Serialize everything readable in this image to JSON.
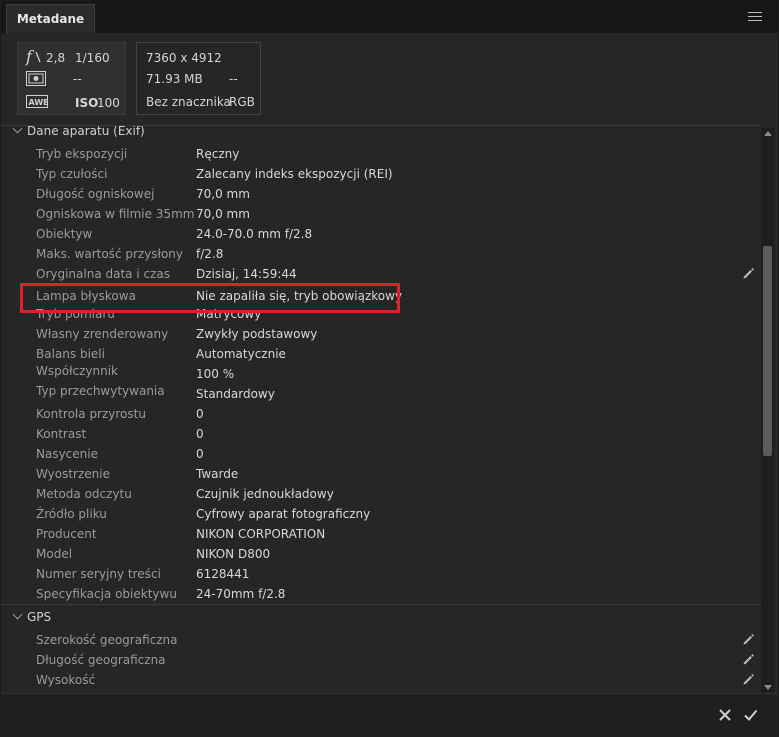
{
  "panel": {
    "tab_label": "Metadane"
  },
  "summary": {
    "aperture": "2,8",
    "shutter": "1/160",
    "metering_value": "--",
    "wb_value": "",
    "iso_label": "ISO",
    "iso_value": "100",
    "dimensions": "7360 x 4912",
    "file_size": "71.93 MB",
    "resolution": "--",
    "label": "Bez znacznika",
    "color_mode": "RGB"
  },
  "sections": {
    "exif_title": "Dane aparatu (Exif)",
    "gps_title": "GPS"
  },
  "exif_rows": [
    {
      "label": "Tryb ekspozycji",
      "value": "Ręczny"
    },
    {
      "label": "Typ czułości",
      "value": "Zalecany indeks ekspozycji (REI)"
    },
    {
      "label": "Długość ogniskowej",
      "value": "70,0 mm"
    },
    {
      "label": "Ogniskowa w filmie 35mm",
      "value": "70,0 mm"
    },
    {
      "label": "Obiektyw",
      "value": "24.0-70.0 mm f/2.8"
    },
    {
      "label": "Maks. wartość przysłony",
      "value": "f/2.8"
    },
    {
      "label": "Oryginalna data i czas",
      "value": "Dzisiaj, 14:59:44"
    },
    {
      "label": "Lampa błyskowa",
      "value": "Nie zapaliła się, tryb obowiązkowy"
    },
    {
      "label": "Tryb pomiaru",
      "value": "Matrycowy"
    },
    {
      "label": "Własny zrenderowany",
      "value": "Zwykły podstawowy"
    },
    {
      "label": "Balans bieli",
      "value": "Automatycznie"
    },
    {
      "label": "Współczynnik",
      "value": "100 %"
    },
    {
      "label": "Typ przechwytywania",
      "value": "Standardowy"
    },
    {
      "label": "Kontrola przyrostu",
      "value": "0"
    },
    {
      "label": "Kontrast",
      "value": "0"
    },
    {
      "label": "Nasycenie",
      "value": "0"
    },
    {
      "label": "Wyostrzenie",
      "value": "Twarde"
    },
    {
      "label": "Metoda odczytu",
      "value": "Czujnik jednoukładowy"
    },
    {
      "label": "Źródło pliku",
      "value": "Cyfrowy aparat fotograficzny"
    },
    {
      "label": "Producent",
      "value": "NIKON CORPORATION"
    },
    {
      "label": "Model",
      "value": "NIKON D800"
    },
    {
      "label": "Numer seryjny treści",
      "value": "6128441"
    },
    {
      "label": "Specyfikacja obiektywu",
      "value": "24-70mm f/2.8"
    }
  ],
  "gps_rows": [
    {
      "label": "Szerokość geograficzna",
      "value": ""
    },
    {
      "label": "Długość geograficzna",
      "value": ""
    },
    {
      "label": "Wysokość",
      "value": ""
    }
  ],
  "icons": {
    "aperture": "aperture-f-icon",
    "metering": "metering-mode-icon",
    "white_balance": "awb-icon",
    "edit": "pencil-icon",
    "cancel": "close-icon",
    "apply": "checkmark-icon",
    "menu": "hamburger-menu-icon"
  },
  "colors": {
    "highlight": "#e0202c",
    "panel_bg": "#262626"
  }
}
